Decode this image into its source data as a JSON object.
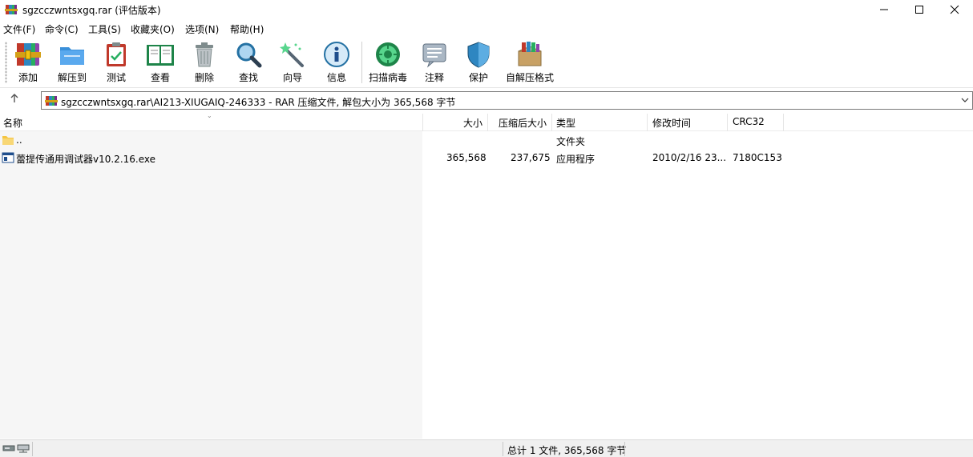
{
  "window": {
    "title": "sgzcczwntsxgq.rar (评估版本)",
    "controls": {
      "minimize": "minimize-icon",
      "maximize": "maximize-icon",
      "close": "close-icon"
    }
  },
  "menu": [
    "文件(F)",
    "命令(C)",
    "工具(S)",
    "收藏夹(O)",
    "选项(N)",
    "帮助(H)"
  ],
  "toolbar": {
    "add": "添加",
    "extract": "解压到",
    "test": "测试",
    "view": "查看",
    "delete": "删除",
    "find": "查找",
    "wizard": "向导",
    "info": "信息",
    "scan": "扫描病毒",
    "comment": "注释",
    "protect": "保护",
    "sfx": "自解压格式"
  },
  "address": {
    "up_icon": "up-arrow-icon",
    "path": "sgzcczwntsxgq.rar\\AI213-XIUGAIQ-246333 - RAR 压缩文件, 解包大小为 365,568 字节"
  },
  "columns": {
    "name": "名称",
    "size": "大小",
    "packed": "压缩后大小",
    "type": "类型",
    "modified": "修改时间",
    "crc": "CRC32"
  },
  "files": [
    {
      "name": "..",
      "size": "",
      "packed": "",
      "type": "文件夹",
      "modified": "",
      "crc": ""
    },
    {
      "name": "蕾提传通用调试器v10.2.16.exe",
      "size": "365,568",
      "packed": "237,675",
      "type": "应用程序",
      "modified": "2010/2/16 23...",
      "crc": "7180C153"
    }
  ],
  "status": {
    "summary": "总计 1 文件, 365,568 字节"
  },
  "colors": {
    "accent": "#0078d7",
    "folder": "#f5c542"
  }
}
